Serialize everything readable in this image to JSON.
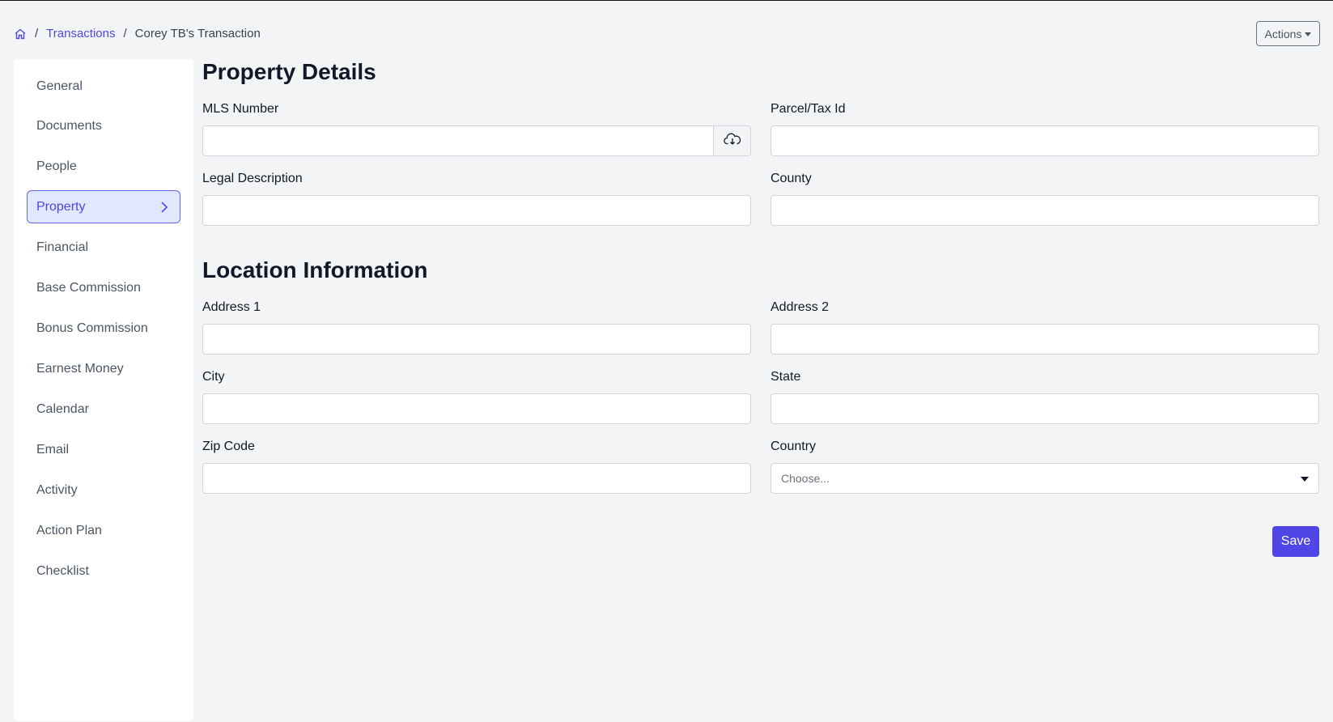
{
  "breadcrumb": {
    "home_icon": "home-icon",
    "separator": "/",
    "transactions": "Transactions",
    "current": "Corey TB's Transaction"
  },
  "header": {
    "actions_label": "Actions"
  },
  "sidebar": {
    "items": [
      {
        "label": "General"
      },
      {
        "label": "Documents"
      },
      {
        "label": "People"
      },
      {
        "label": "Property",
        "active": true
      },
      {
        "label": "Financial"
      },
      {
        "label": "Base Commission"
      },
      {
        "label": "Bonus Commission"
      },
      {
        "label": "Earnest Money"
      },
      {
        "label": "Calendar"
      },
      {
        "label": "Email"
      },
      {
        "label": "Activity"
      },
      {
        "label": "Action Plan"
      },
      {
        "label": "Checklist"
      }
    ]
  },
  "property_details": {
    "title": "Property Details",
    "mls_number": {
      "label": "MLS Number",
      "value": "",
      "icon": "cloud-download-icon"
    },
    "parcel_tax_id": {
      "label": "Parcel/Tax Id",
      "value": ""
    },
    "legal_description": {
      "label": "Legal Description",
      "value": ""
    },
    "county": {
      "label": "County",
      "value": ""
    }
  },
  "location_information": {
    "title": "Location Information",
    "address1": {
      "label": "Address 1",
      "value": ""
    },
    "address2": {
      "label": "Address 2",
      "value": ""
    },
    "city": {
      "label": "City",
      "value": ""
    },
    "state": {
      "label": "State",
      "value": ""
    },
    "zip_code": {
      "label": "Zip Code",
      "value": ""
    },
    "country": {
      "label": "Country",
      "selected": "Choose..."
    }
  },
  "save_label": "Save",
  "colors": {
    "accent": "#4f46e5",
    "active_bg": "#e0e7ff",
    "page_bg": "#f3f4f6"
  }
}
